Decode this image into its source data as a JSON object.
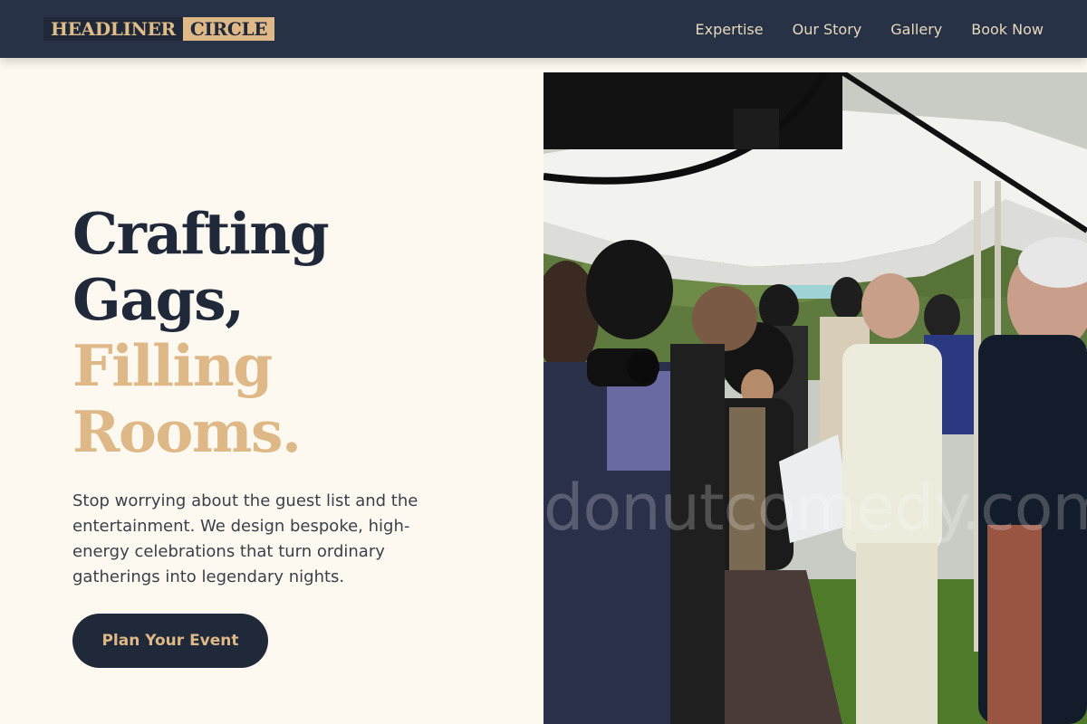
{
  "brand": {
    "part_1": "HEADLINER",
    "part_2": "CIRCLE"
  },
  "nav": {
    "items": [
      {
        "label": "Expertise"
      },
      {
        "label": "Our Story"
      },
      {
        "label": "Gallery"
      },
      {
        "label": "Book Now"
      }
    ]
  },
  "hero": {
    "headline_line_1": "Crafting",
    "headline_line_2": "Gags,",
    "headline_line_3": "Filling",
    "headline_line_4": "Rooms.",
    "description": "Stop worrying about the guest list and the entertainment. We design bespoke, high-energy celebrations that turn ordinary gatherings into legendary nights.",
    "cta_label": "Plan Your Event",
    "photo_watermark": "donutcomedy.com"
  },
  "colors": {
    "navy": "#1f293a",
    "navbar": "#273246",
    "gold": "#deb887",
    "cream_background": "#fef9f0",
    "body_text": "#3a3f4a"
  }
}
